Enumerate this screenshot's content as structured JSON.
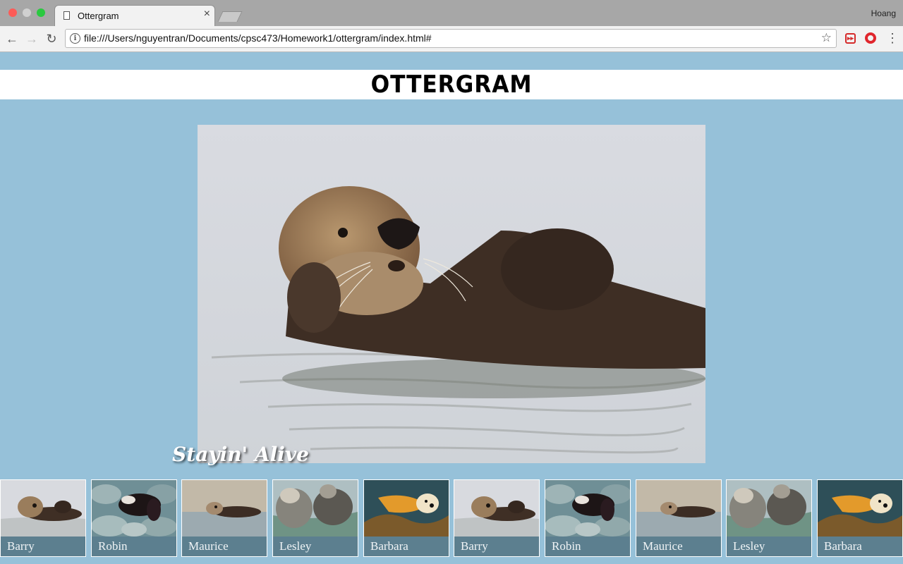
{
  "browser": {
    "tab_title": "Ottergram",
    "tab_close": "×",
    "profile_name": "Hoang",
    "url": "file:///Users/nguyentran/Documents/cpsc473/Homework1/ottergram/index.html#",
    "back": "←",
    "forward": "→",
    "reload": "↻",
    "star": "☆",
    "info": "i",
    "menu": "⋮"
  },
  "page": {
    "logo": "OTTERGRAM",
    "detail_title": "Stayin' Alive",
    "detail_image_icon": "sea-otter-photo"
  },
  "thumbnails": [
    {
      "label": "Barry",
      "scene": "otter-floating-calm-water"
    },
    {
      "label": "Robin",
      "scene": "otter-on-rocks"
    },
    {
      "label": "Maurice",
      "scene": "otter-swimming-water"
    },
    {
      "label": "Lesley",
      "scene": "two-otters-cuddling"
    },
    {
      "label": "Barbara",
      "scene": "otter-in-kelp"
    },
    {
      "label": "Barry",
      "scene": "otter-floating-calm-water"
    },
    {
      "label": "Robin",
      "scene": "otter-on-rocks"
    },
    {
      "label": "Maurice",
      "scene": "otter-swimming-water"
    },
    {
      "label": "Lesley",
      "scene": "two-otters-cuddling"
    },
    {
      "label": "Barbara",
      "scene": "otter-in-kelp"
    }
  ],
  "colors": {
    "page_background": "#96c1d9",
    "thumbnail_label_bar": "#5c7f8f"
  }
}
